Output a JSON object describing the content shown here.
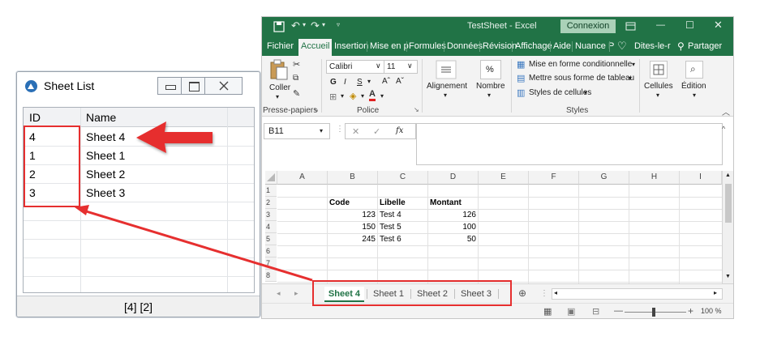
{
  "sheet_list_window": {
    "title": "Sheet List",
    "columns": [
      "ID",
      "Name"
    ],
    "rows": [
      {
        "id": "4",
        "name": "Sheet 4"
      },
      {
        "id": "1",
        "name": "Sheet 1"
      },
      {
        "id": "2",
        "name": "Sheet 2"
      },
      {
        "id": "3",
        "name": "Sheet 3"
      }
    ],
    "status_text": "[4] [2]"
  },
  "excel": {
    "title": "TestSheet  -  Excel",
    "connexion_label": "Connexion",
    "ribbon_tabs": [
      "Fichier",
      "Accueil",
      "Insertion",
      "Mise en p",
      "Formules",
      "Données",
      "Révision",
      "Affichage",
      "Aide",
      "Nuance P"
    ],
    "active_tab": "Accueil",
    "tell_me": "Dites-le-r",
    "share_label": "Partager",
    "ribbon": {
      "paste_label": "Coller",
      "font_name": "Calibri",
      "font_size": "11",
      "clipboard_group": "Presse-papiers",
      "font_group": "Police",
      "alignment_label": "Alignement",
      "number_label": "Nombre",
      "percent_symbol": "%",
      "cond_format": "Mise en forme conditionnelle",
      "format_table": "Mettre sous forme de tableau",
      "cell_styles": "Styles de cellules",
      "styles_group": "Styles",
      "cells_label": "Cellules",
      "edit_label": "Édition",
      "bold": "G",
      "italic": "I",
      "underline": "S"
    },
    "name_box": "B11",
    "fx_label": "fx",
    "columns": [
      "A",
      "B",
      "C",
      "D",
      "E",
      "F",
      "G",
      "H",
      "I"
    ],
    "row_numbers": [
      "1",
      "2",
      "3",
      "4",
      "5",
      "6",
      "7",
      "8"
    ],
    "cells": {
      "header": {
        "code": "Code",
        "libelle": "Libelle",
        "montant": "Montant"
      },
      "data": [
        {
          "code": "123",
          "libelle": "Test 4",
          "montant": "126"
        },
        {
          "code": "150",
          "libelle": "Test 5",
          "montant": "100"
        },
        {
          "code": "245",
          "libelle": "Test 6",
          "montant": "50"
        }
      ]
    },
    "sheet_tabs": [
      "Sheet 4",
      "Sheet 1",
      "Sheet 2",
      "Sheet 3"
    ],
    "active_sheet": "Sheet 4",
    "zoom": "100 %"
  },
  "colors": {
    "excel_green": "#217346",
    "annotation_red": "#e62f2f"
  }
}
